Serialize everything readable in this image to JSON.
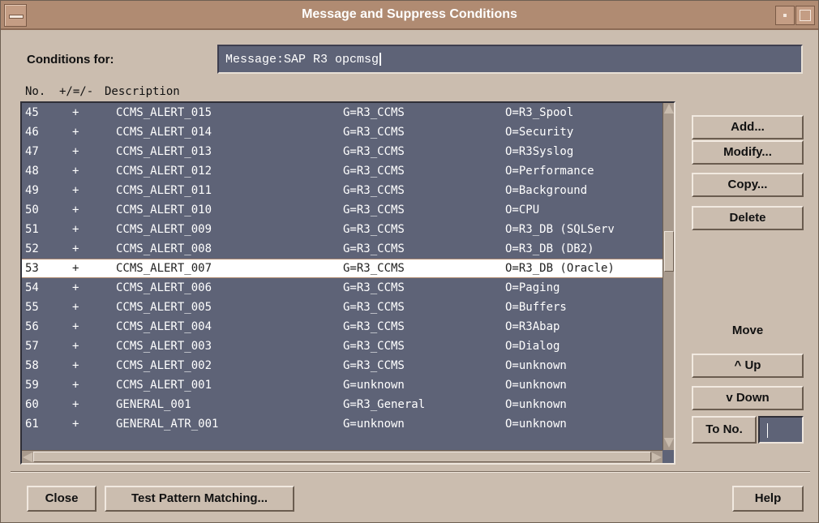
{
  "window": {
    "title": "Message and Suppress Conditions"
  },
  "conditions": {
    "label": "Conditions for:",
    "value": "Message:SAP R3 opcmsg"
  },
  "list": {
    "headers": {
      "no": "No.",
      "sign": "+/=/-",
      "description": "Description"
    },
    "selected_index": 8,
    "rows": [
      {
        "no": "45",
        "sign": "+",
        "desc": "CCMS_ALERT_015",
        "group": "G=R3_CCMS",
        "object": "O=R3_Spool"
      },
      {
        "no": "46",
        "sign": "+",
        "desc": "CCMS_ALERT_014",
        "group": "G=R3_CCMS",
        "object": "O=Security"
      },
      {
        "no": "47",
        "sign": "+",
        "desc": "CCMS_ALERT_013",
        "group": "G=R3_CCMS",
        "object": "O=R3Syslog"
      },
      {
        "no": "48",
        "sign": "+",
        "desc": "CCMS_ALERT_012",
        "group": "G=R3_CCMS",
        "object": "O=Performance"
      },
      {
        "no": "49",
        "sign": "+",
        "desc": "CCMS_ALERT_011",
        "group": "G=R3_CCMS",
        "object": "O=Background"
      },
      {
        "no": "50",
        "sign": "+",
        "desc": "CCMS_ALERT_010",
        "group": "G=R3_CCMS",
        "object": "O=CPU"
      },
      {
        "no": "51",
        "sign": "+",
        "desc": "CCMS_ALERT_009",
        "group": "G=R3_CCMS",
        "object": "O=R3_DB (SQLServ"
      },
      {
        "no": "52",
        "sign": "+",
        "desc": "CCMS_ALERT_008",
        "group": "G=R3_CCMS",
        "object": "O=R3_DB (DB2)"
      },
      {
        "no": "53",
        "sign": "+",
        "desc": "CCMS_ALERT_007",
        "group": "G=R3_CCMS",
        "object": "O=R3_DB (Oracle)"
      },
      {
        "no": "54",
        "sign": "+",
        "desc": "CCMS_ALERT_006",
        "group": "G=R3_CCMS",
        "object": "O=Paging"
      },
      {
        "no": "55",
        "sign": "+",
        "desc": "CCMS_ALERT_005",
        "group": "G=R3_CCMS",
        "object": "O=Buffers"
      },
      {
        "no": "56",
        "sign": "+",
        "desc": "CCMS_ALERT_004",
        "group": "G=R3_CCMS",
        "object": "O=R3Abap"
      },
      {
        "no": "57",
        "sign": "+",
        "desc": "CCMS_ALERT_003",
        "group": "G=R3_CCMS",
        "object": "O=Dialog"
      },
      {
        "no": "58",
        "sign": "+",
        "desc": "CCMS_ALERT_002",
        "group": "G=R3_CCMS",
        "object": "O=unknown"
      },
      {
        "no": "59",
        "sign": "+",
        "desc": "CCMS_ALERT_001",
        "group": "G=unknown",
        "object": "O=unknown"
      },
      {
        "no": "60",
        "sign": "+",
        "desc": "GENERAL_001",
        "group": "G=R3_General",
        "object": "O=unknown"
      },
      {
        "no": "61",
        "sign": "+",
        "desc": "GENERAL_ATR_001",
        "group": "G=unknown",
        "object": "O=unknown"
      }
    ]
  },
  "actions": {
    "add": "Add...",
    "modify": "Modify...",
    "copy": "Copy...",
    "delete": "Delete"
  },
  "move": {
    "label": "Move",
    "up": "^ Up",
    "down": "v Down",
    "to_no": "To No.",
    "to_no_value": ""
  },
  "footer": {
    "close": "Close",
    "test": "Test Pattern Matching...",
    "help": "Help"
  },
  "colors": {
    "titlebar": "#b08b72",
    "list_bg": "#5e6377",
    "window_bg": "#cbbdaf",
    "selected_row_bg": "#ffffff"
  }
}
